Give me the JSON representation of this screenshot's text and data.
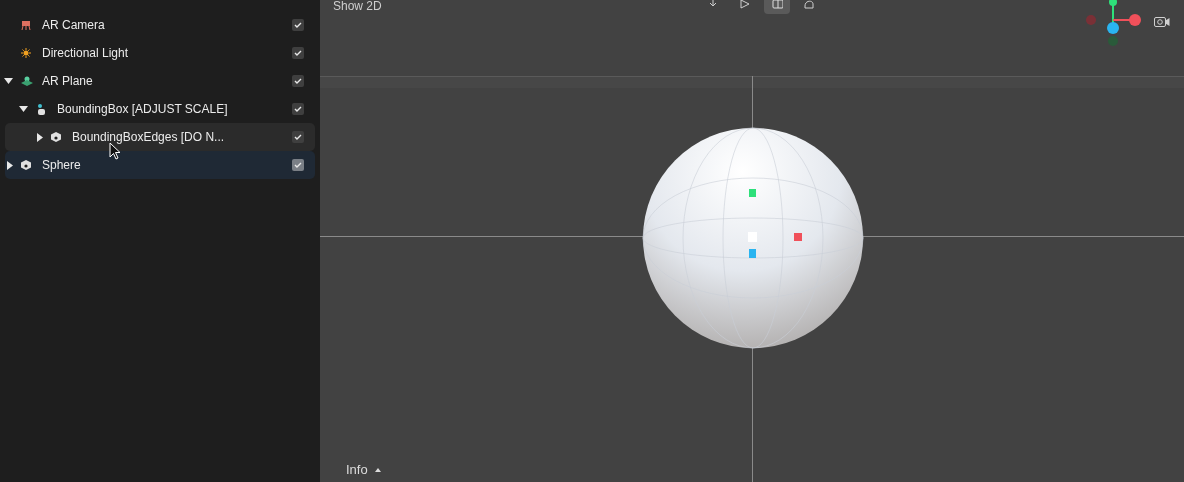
{
  "hierarchy": [
    {
      "label": "AR Camera",
      "kind": "camera",
      "checked": true,
      "selected": false,
      "hovered": false
    },
    {
      "label": "Directional Light",
      "kind": "light",
      "checked": true,
      "selected": false,
      "hovered": false
    },
    {
      "label": "AR Plane",
      "kind": "plane",
      "checked": true,
      "selected": false,
      "hovered": false,
      "expanded": true,
      "children": [
        {
          "label": "BoundingBox [ADJUST SCALE]",
          "kind": "anchor",
          "checked": true,
          "selected": false,
          "hovered": false,
          "expanded": true,
          "children": [
            {
              "label": "BoundingBoxEdges [DO N...",
              "kind": "mesh",
              "checked": true,
              "selected": false,
              "hovered": true,
              "expanded": false
            }
          ]
        }
      ]
    },
    {
      "label": "Sphere",
      "kind": "mesh",
      "checked": true,
      "selected": true,
      "hovered": false,
      "expanded": false
    }
  ],
  "viewport": {
    "show_2d_label": "Show 2D",
    "toolbar": [
      {
        "selected": false
      },
      {
        "selected": false
      },
      {
        "selected": true
      },
      {
        "selected": false
      }
    ],
    "info_label": "Info"
  }
}
